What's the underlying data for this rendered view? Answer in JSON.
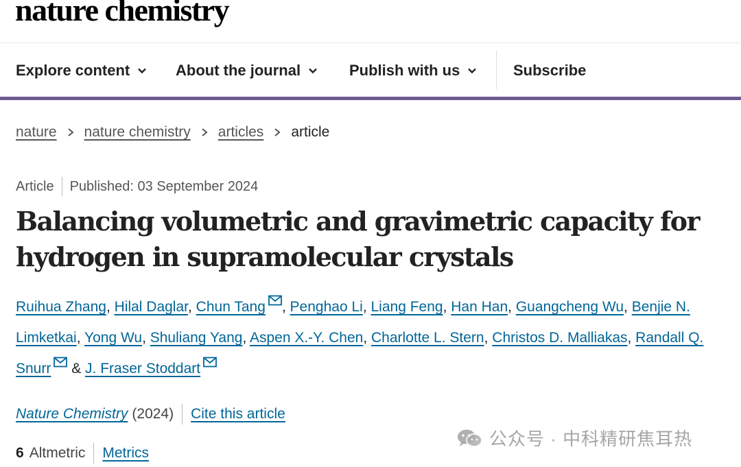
{
  "brand": {
    "logo": "nature chemistry"
  },
  "nav": {
    "explore": "Explore content",
    "about": "About the journal",
    "publish": "Publish with us",
    "subscribe": "Subscribe"
  },
  "breadcrumb": [
    "nature",
    "nature chemistry",
    "articles",
    "article"
  ],
  "meta": {
    "type": "Article",
    "published": "Published: 03 September 2024"
  },
  "title": "Balancing volumetric and gravimetric capacity for hydrogen in supramolecular crystals",
  "authors": [
    "Ruihua Zhang",
    "Hilal Daglar",
    "Chun Tang",
    "Penghao Li",
    "Liang Feng",
    "Han Han",
    "Guangcheng Wu",
    "Benjie N. Limketkai",
    "Yong Wu",
    "Shuliang Yang",
    "Aspen X.-Y. Chen",
    "Charlotte L. Stern",
    "Christos D. Malliakas",
    "Randall Q. Snurr",
    "J. Fraser Stoddart"
  ],
  "authors_sep": ", ",
  "authors_and": " & ",
  "citation": {
    "journal": "Nature Chemistry",
    "year": "(2024)",
    "cite_label": "Cite this article"
  },
  "altmetric": {
    "score": "6",
    "label": "Altmetric",
    "metrics": "Metrics"
  },
  "watermark": "公众号 · 中科精研焦耳热",
  "colors": {
    "link": "#006699",
    "accent_bar": "#6f5a8e"
  }
}
